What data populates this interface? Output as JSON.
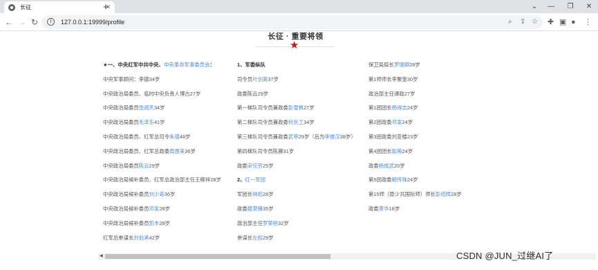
{
  "browser": {
    "tab_title": "长征",
    "tab_close": "✕",
    "new_tab": "+",
    "window": {
      "minimize": "—",
      "restore": "❐",
      "close": "✕"
    },
    "url": "127.0.0.1:19999/profile"
  },
  "page": {
    "title": "长征 · 重要将领",
    "star": "★"
  },
  "columns": [
    [
      {
        "heading": true,
        "segments": [
          {
            "t": "★一、中央红军中共中央、"
          },
          {
            "t": "中央革命军事委员会",
            "hl": true
          },
          {
            "t": "："
          }
        ]
      },
      {
        "segments": [
          {
            "t": "中央军事顾问：李德"
          },
          {
            "t": "34岁",
            "n": true
          }
        ]
      },
      {
        "segments": [
          {
            "t": "中央政治局委员、临时中央负责人博古"
          },
          {
            "t": "27岁",
            "n": true
          }
        ]
      },
      {
        "segments": [
          {
            "t": "中央政治局委员"
          },
          {
            "t": "张闻天",
            "hl": true
          },
          {
            "t": "34岁",
            "n": true
          }
        ]
      },
      {
        "segments": [
          {
            "t": "中央政治局委员"
          },
          {
            "t": "毛泽东",
            "hl": true
          },
          {
            "t": "41岁",
            "n": true
          }
        ]
      },
      {
        "segments": [
          {
            "t": "中央政治局委员、红军总司令"
          },
          {
            "t": "朱德",
            "hl": true
          },
          {
            "t": "48岁",
            "n": true
          }
        ]
      },
      {
        "segments": [
          {
            "t": "中央政治局委员、红军总政委"
          },
          {
            "t": "周恩来",
            "hl": true
          },
          {
            "t": "36岁",
            "n": true
          }
        ]
      },
      {
        "segments": [
          {
            "t": "中央政治局委员"
          },
          {
            "t": "陈云",
            "hl": true
          },
          {
            "t": "29岁",
            "n": true
          }
        ]
      },
      {
        "segments": [
          {
            "t": "中央政治局候补委员、红军总政治部主任王稼祥"
          },
          {
            "t": "28岁",
            "n": true
          }
        ]
      },
      {
        "segments": [
          {
            "t": "中央政治局候补委员"
          },
          {
            "t": "刘少奇",
            "hl": true
          },
          {
            "t": "36岁",
            "n": true
          }
        ]
      },
      {
        "segments": [
          {
            "t": "中央政治局候补委员"
          },
          {
            "t": "邓发",
            "hl": true
          },
          {
            "t": "28岁",
            "n": true
          }
        ]
      },
      {
        "segments": [
          {
            "t": "中央政治局候补委员"
          },
          {
            "t": "凯丰",
            "hl": true
          },
          {
            "t": "28岁",
            "n": true
          }
        ]
      },
      {
        "segments": [
          {
            "t": "红军总参谋长"
          },
          {
            "t": "刘伯承",
            "hl": true
          },
          {
            "t": "42岁",
            "n": true
          }
        ]
      }
    ],
    [
      {
        "heading": true,
        "segments": [
          {
            "t": "1、军委纵队"
          }
        ]
      },
      {
        "segments": [
          {
            "t": "司令员"
          },
          {
            "t": "叶剑英",
            "hl": true
          },
          {
            "t": "37岁",
            "n": true
          }
        ]
      },
      {
        "segments": [
          {
            "t": "政委陈云"
          },
          {
            "t": "29岁",
            "n": true
          }
        ]
      },
      {
        "segments": [
          {
            "t": "第一梯队司令员兼政委"
          },
          {
            "t": "彭雪枫",
            "hl": true
          },
          {
            "t": "27岁",
            "n": true
          }
        ]
      },
      {
        "segments": [
          {
            "t": "第二梯队司令员兼政委"
          },
          {
            "t": "何长工",
            "hl": true
          },
          {
            "t": "34岁",
            "n": true
          }
        ]
      },
      {
        "segments": [
          {
            "t": "第三梯队司令员兼政委"
          },
          {
            "t": "武亭",
            "hl": true
          },
          {
            "t": "29岁（后为"
          },
          {
            "t": "李维汉",
            "hl": true
          },
          {
            "t": "38岁）"
          }
        ]
      },
      {
        "segments": [
          {
            "t": "第四梯队司令员陈赓"
          },
          {
            "t": "31岁",
            "n": true
          }
        ]
      },
      {
        "segments": [
          {
            "t": "政委"
          },
          {
            "t": "宋任穷",
            "hl": true
          },
          {
            "t": "25岁",
            "n": true
          }
        ]
      },
      {
        "heading": true,
        "segments": [
          {
            "t": "2、"
          },
          {
            "t": "红一军团",
            "hl": true
          }
        ]
      },
      {
        "segments": [
          {
            "t": "军团长"
          },
          {
            "t": "林彪",
            "hl": true
          },
          {
            "t": "28岁",
            "n": true
          }
        ]
      },
      {
        "segments": [
          {
            "t": "政委"
          },
          {
            "t": "聂荣臻",
            "hl": true
          },
          {
            "t": "35岁",
            "n": true
          }
        ]
      },
      {
        "segments": [
          {
            "t": "政治部主任"
          },
          {
            "t": "罗荣桓",
            "hl": true
          },
          {
            "t": "32岁",
            "n": true
          }
        ]
      },
      {
        "segments": [
          {
            "t": "参谋长"
          },
          {
            "t": "左权",
            "hl": true
          },
          {
            "t": "29岁",
            "n": true
          }
        ]
      }
    ],
    [
      {
        "segments": [
          {
            "t": "保卫局局长"
          },
          {
            "t": "罗瑞卿",
            "hl": true
          },
          {
            "t": "28岁",
            "n": true
          }
        ]
      },
      {
        "segments": [
          {
            "t": "第1师师长李聚奎"
          },
          {
            "t": "30岁",
            "n": true
          }
        ]
      },
      {
        "segments": [
          {
            "t": "政治部主任谭政"
          },
          {
            "t": "27岁",
            "n": true
          }
        ]
      },
      {
        "segments": [
          {
            "t": "第1团团长"
          },
          {
            "t": "杨得志",
            "hl": true
          },
          {
            "t": "24岁",
            "n": true
          }
        ]
      },
      {
        "segments": [
          {
            "t": "第2团政委"
          },
          {
            "t": "邓发",
            "hl": true
          },
          {
            "t": "24岁",
            "n": true
          }
        ]
      },
      {
        "segments": [
          {
            "t": "第3团政委刘亚楼"
          },
          {
            "t": "23岁",
            "n": true
          }
        ]
      },
      {
        "segments": [
          {
            "t": "第4团团长"
          },
          {
            "t": "耿飚",
            "hl": true
          },
          {
            "t": "24岁",
            "n": true
          }
        ]
      },
      {
        "segments": [
          {
            "t": "政委"
          },
          {
            "t": "杨成武",
            "hl": true
          },
          {
            "t": "20岁",
            "n": true
          }
        ]
      },
      {
        "segments": [
          {
            "t": "第5团政委"
          },
          {
            "t": "赖传珠",
            "hl": true
          },
          {
            "t": "24岁",
            "n": true
          }
        ]
      },
      {
        "segments": [
          {
            "t": "第15师（原少共国际师）师长"
          },
          {
            "t": "彭绍辉",
            "hl": true
          },
          {
            "t": "28岁",
            "n": true
          }
        ]
      },
      {
        "segments": [
          {
            "t": "政委"
          },
          {
            "t": "萧华",
            "hl": true
          },
          {
            "t": "18岁",
            "n": true
          }
        ]
      }
    ]
  ],
  "watermark": "CSDN @JUN_过继AI了"
}
